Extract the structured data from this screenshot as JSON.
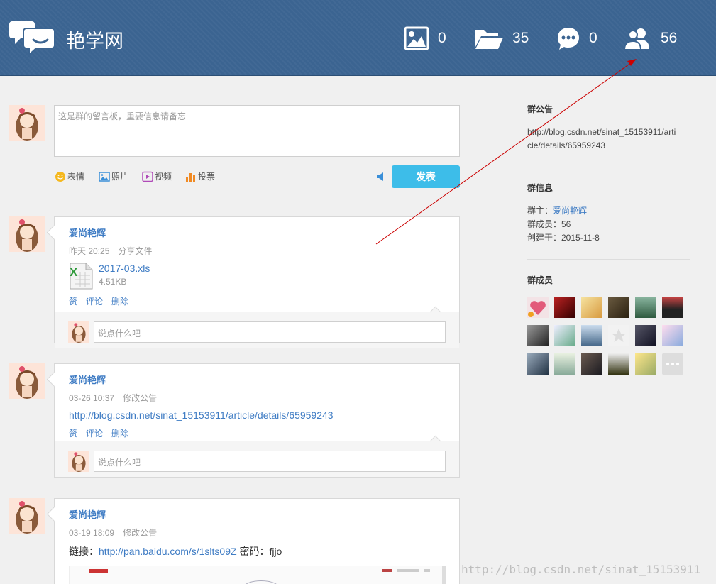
{
  "header": {
    "site_title": "艳学网",
    "stats": [
      {
        "icon": "image-icon",
        "count": "0"
      },
      {
        "icon": "folder-icon",
        "count": "35"
      },
      {
        "icon": "chat-icon",
        "count": "0"
      },
      {
        "icon": "members-icon",
        "count": "56"
      }
    ]
  },
  "composer": {
    "placeholder": "这是群的留言板，重要信息请备忘",
    "tools": [
      "表情",
      "照片",
      "视频",
      "投票"
    ],
    "post_label": "发表"
  },
  "posts": [
    {
      "author": "爱尚艳辉",
      "time": "昨天 20:25",
      "action": "分享文件",
      "file_name": "2017-03.xls",
      "file_size": "4.51KB",
      "reply_placeholder": "说点什么吧"
    },
    {
      "author": "爱尚艳辉",
      "time": "03-26 10:37",
      "action": "修改公告",
      "link": "http://blog.csdn.net/sinat_15153911/article/details/65959243",
      "reply_placeholder": "说点什么吧"
    },
    {
      "author": "爱尚艳辉",
      "time": "03-19 18:09",
      "action": "修改公告",
      "text_prefix": "链接：",
      "link": "http://pan.baidu.com/s/1slts09Z",
      "text_suffix": " 密码：fjjo"
    }
  ],
  "post_actions": [
    "赞",
    "评论",
    "删除"
  ],
  "sidebar": {
    "notice_title": "群公告",
    "notice_text_1": "http://blog.csdn.net/sinat_15153911/arti",
    "notice_text_2": "cle/details/65959243",
    "info_title": "群信息",
    "owner_label": "群主：",
    "owner_name": "爱尚艳辉",
    "members_line": "群成员：56",
    "created_line": "创建于：2015-11-8",
    "members_title": "群成员"
  },
  "watermark": "http://blog.csdn.net/sinat_15153911",
  "colors": {
    "header": "#3b6491",
    "accent_blue": "#3f7cc4",
    "post_button": "#3dbde9",
    "annotation_arrow": "#cc0000"
  }
}
